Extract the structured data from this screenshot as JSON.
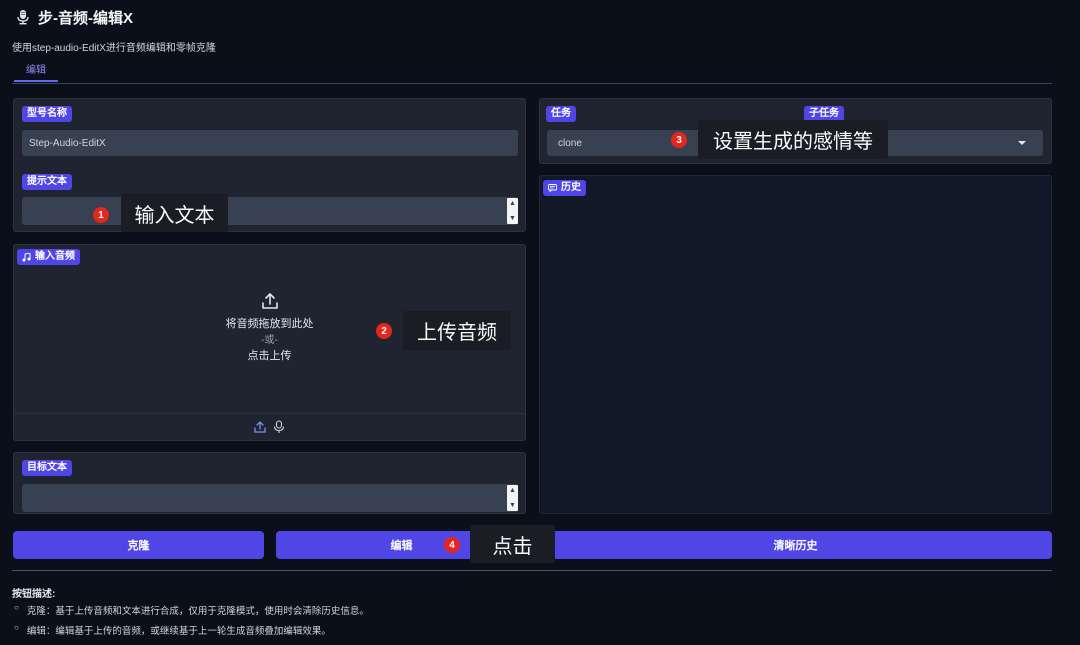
{
  "header": {
    "title": "步-音频-编辑X",
    "subtitle": "使用step-audio-EditX进行音频编辑和零帧克隆"
  },
  "tabs": [
    {
      "label": "编辑"
    }
  ],
  "left": {
    "model_label": "型号名称",
    "model_value": "Step-Audio-EditX",
    "prompt_label": "提示文本",
    "prompt_value": "",
    "audio_label": "输入音频",
    "upload_line1": "将音频拖放到此处",
    "upload_or": "-或-",
    "upload_line2": "点击上传",
    "target_label": "目标文本",
    "target_value": ""
  },
  "right": {
    "task_label": "任务",
    "task_value": "clone",
    "subtask_label": "子任务",
    "history_label": "历史"
  },
  "buttons": {
    "clone": "克隆",
    "edit": "编辑",
    "clear_history": "清晰历史"
  },
  "description": {
    "title": "按钮描述:",
    "items": [
      "克隆：基于上传音频和文本进行合成，仅用于克隆模式，使用时会清除历史信息。",
      "编辑：编辑基于上传的音频，或继续基于上一轮生成音频叠加编辑效果。"
    ]
  },
  "annotations": [
    {
      "num": "1",
      "text": "输入文本"
    },
    {
      "num": "2",
      "text": "上传音频"
    },
    {
      "num": "3",
      "text": "设置生成的感情等"
    },
    {
      "num": "4",
      "text": "点击"
    }
  ],
  "colors": {
    "accent": "#4f46e5",
    "background": "#0b0f19",
    "panel": "#1f2430",
    "badge": "#e5261c"
  }
}
